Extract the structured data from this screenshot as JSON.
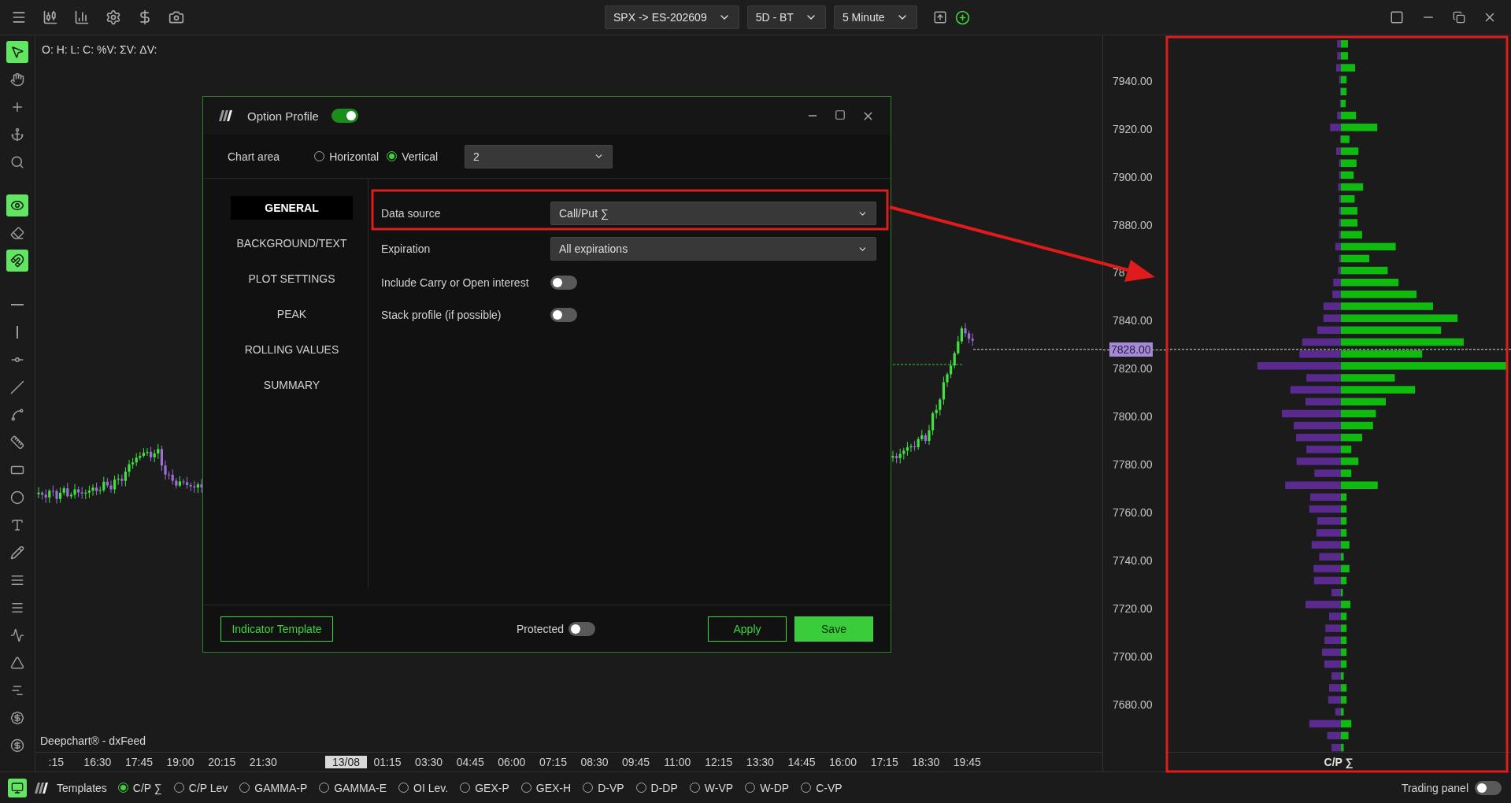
{
  "top_bar": {
    "selectors": [
      {
        "label": "SPX -> ES-202609"
      },
      {
        "label": "5D - BT"
      },
      {
        "label": "5 Minute"
      }
    ]
  },
  "left_toolbar": [
    {
      "active": true
    },
    {
      "active": false
    },
    {
      "active": false
    },
    {
      "active": false
    },
    {
      "active": false
    },
    {
      "active": true
    },
    {
      "active": false
    },
    {
      "active": true
    },
    {
      "active": false
    },
    {
      "active": false
    },
    {
      "active": false
    },
    {
      "active": false
    },
    {
      "active": false
    },
    {
      "active": false
    },
    {
      "active": false
    },
    {
      "active": false
    },
    {
      "active": false
    },
    {
      "active": false
    },
    {
      "active": false
    },
    {
      "active": false
    },
    {
      "active": false
    },
    {
      "active": false
    },
    {
      "active": false
    },
    {
      "active": false
    },
    {
      "active": false
    }
  ],
  "chart": {
    "ohlc_legend": "O: H: L: C: %V: ΣV: ΔV:",
    "source_label": "Deepchart® - dxFeed",
    "time_axis": [
      {
        "label": ":15",
        "highlighted": false
      },
      {
        "label": "16:30",
        "highlighted": false
      },
      {
        "label": "17:45",
        "highlighted": false
      },
      {
        "label": "19:00",
        "highlighted": false
      },
      {
        "label": "20:15",
        "highlighted": false
      },
      {
        "label": "21:30",
        "highlighted": false
      },
      {
        "label": "13/08",
        "highlighted": true
      },
      {
        "label": "01:15",
        "highlighted": false
      },
      {
        "label": "03:30",
        "highlighted": false
      },
      {
        "label": "04:45",
        "highlighted": false
      },
      {
        "label": "06:00",
        "highlighted": false
      },
      {
        "label": "07:15",
        "highlighted": false
      },
      {
        "label": "08:30",
        "highlighted": false
      },
      {
        "label": "09:45",
        "highlighted": false
      },
      {
        "label": "11:00",
        "highlighted": false
      },
      {
        "label": "12:15",
        "highlighted": false
      },
      {
        "label": "13:30",
        "highlighted": false
      },
      {
        "label": "14:45",
        "highlighted": false
      },
      {
        "label": "16:00",
        "highlighted": false
      },
      {
        "label": "17:15",
        "highlighted": false
      },
      {
        "label": "18:30",
        "highlighted": false
      },
      {
        "label": "19:45",
        "highlighted": false
      }
    ]
  },
  "price_axis": {
    "ticks": [
      "7940.00",
      "7920.00",
      "7900.00",
      "7880.00",
      "78",
      "7840.00",
      "7820.00",
      "7800.00",
      "7780.00",
      "7760.00",
      "7740.00",
      "7720.00",
      "7700.00",
      "7680.00"
    ],
    "current_price": "7828.00"
  },
  "profile": {
    "label": "C/P ∑"
  },
  "dialog": {
    "title": "Option Profile",
    "enabled": true,
    "chart_area": {
      "label": "Chart area",
      "options": [
        {
          "label": "Horizontal",
          "selected": false
        },
        {
          "label": "Vertical",
          "selected": true
        }
      ],
      "value": "2"
    },
    "nav": [
      {
        "label": "GENERAL",
        "selected": true
      },
      {
        "label": "BACKGROUND/TEXT",
        "selected": false
      },
      {
        "label": "PLOT SETTINGS",
        "selected": false
      },
      {
        "label": "PEAK",
        "selected": false
      },
      {
        "label": "ROLLING VALUES",
        "selected": false
      },
      {
        "label": "SUMMARY",
        "selected": false
      }
    ],
    "fields": [
      {
        "kind": "select",
        "label": "Data source",
        "value": "Call/Put ∑"
      },
      {
        "kind": "select",
        "label": "Expiration",
        "value": "All expirations"
      },
      {
        "kind": "toggle",
        "label": "Include Carry or Open interest",
        "on": false
      },
      {
        "kind": "toggle",
        "label": "Stack profile (if possible)",
        "on": false
      }
    ],
    "footer": {
      "template_button": "Indicator Template",
      "protected": {
        "label": "Protected",
        "on": false
      },
      "apply": "Apply",
      "save": "Save"
    }
  },
  "bottom_bar": {
    "layout_active": true,
    "templates_label": "Templates",
    "templates": [
      {
        "label": "C/P ∑",
        "selected": true
      },
      {
        "label": "C/P Lev",
        "selected": false
      },
      {
        "label": "GAMMA-P",
        "selected": false
      },
      {
        "label": "GAMMA-E",
        "selected": false
      },
      {
        "label": "OI Lev.",
        "selected": false
      },
      {
        "label": "GEX-P",
        "selected": false
      },
      {
        "label": "GEX-H",
        "selected": false
      },
      {
        "label": "D-VP",
        "selected": false
      },
      {
        "label": "D-DP",
        "selected": false
      },
      {
        "label": "W-VP",
        "selected": false
      },
      {
        "label": "W-DP",
        "selected": false
      },
      {
        "label": "C-VP",
        "selected": false
      }
    ],
    "trading_panel": {
      "label": "Trading panel",
      "on": false
    }
  }
}
